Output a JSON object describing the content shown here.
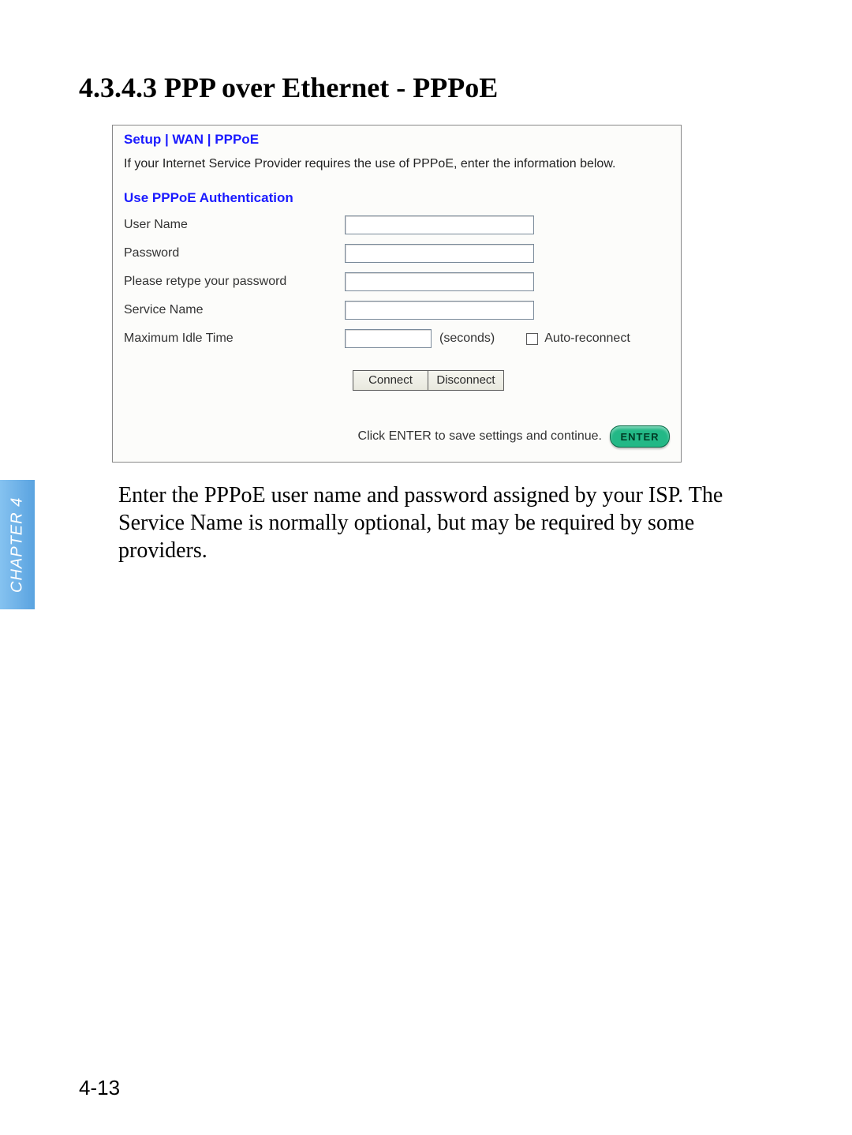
{
  "heading": "4.3.4.3 PPP over Ethernet - PPPoE",
  "panel": {
    "breadcrumb": "Setup | WAN | PPPoE",
    "intro": "If your Internet Service Provider requires the use of PPPoE, enter the information below.",
    "auth_heading": "Use PPPoE Authentication",
    "fields": {
      "username_label": "User Name",
      "password_label": "Password",
      "retype_label": "Please retype your password",
      "service_label": "Service Name",
      "idle_label": "Maximum Idle Time",
      "seconds_label": "(seconds)",
      "auto_reconnect_label": "Auto-reconnect"
    },
    "buttons": {
      "connect": "Connect",
      "disconnect": "Disconnect"
    },
    "footer": {
      "text": "Click ENTER to save settings and continue.",
      "enter": "ENTER"
    }
  },
  "body_text": "Enter the PPPoE user name and password assigned by your ISP. The Service Name is normally optional, but may be required by some providers.",
  "chapter_tab": "CHAPTER 4",
  "page_number": "4-13"
}
